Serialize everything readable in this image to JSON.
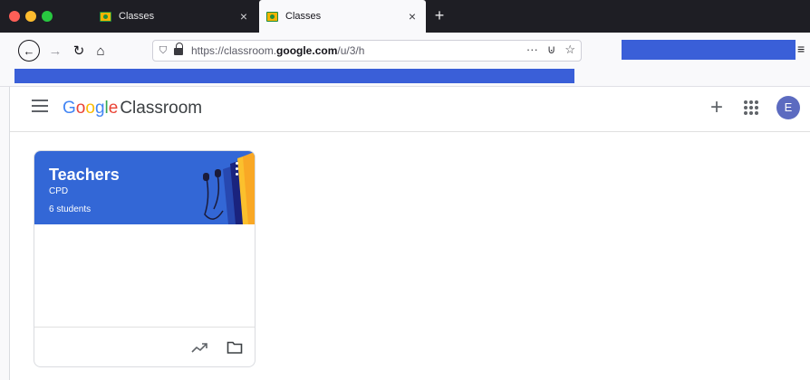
{
  "browser": {
    "tabs": [
      {
        "title": "Classes",
        "active": false
      },
      {
        "title": "Classes",
        "active": true
      }
    ],
    "tab_close_glyph": "×",
    "new_tab_glyph": "+",
    "url": {
      "prefix": "https://classroom.",
      "domain": "google.com",
      "suffix": "/u/3/h"
    },
    "url_actions": {
      "more": "···",
      "pocket": "⊍",
      "bookmark": "☆"
    }
  },
  "app": {
    "brand_letters": [
      "G",
      "o",
      "o",
      "g",
      "l",
      "e"
    ],
    "product_name": "Classroom",
    "avatar_initial": "E",
    "create_glyph": "+"
  },
  "classes": [
    {
      "name": "Teachers",
      "section": "CPD",
      "students_label": "6 students"
    }
  ],
  "colors": {
    "banner": "#3367d6",
    "avatar": "#5c6bc0",
    "redaction": "#3a5fd8"
  },
  "icons": [
    "back-arrow-icon",
    "forward-arrow-icon",
    "reload-icon",
    "home-icon",
    "shield-icon",
    "lock-icon",
    "hamburger-icon",
    "apps-grid-icon",
    "trending-icon",
    "folder-icon"
  ]
}
